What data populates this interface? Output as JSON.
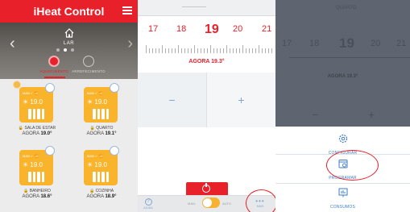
{
  "app": {
    "title": "iHeat Control"
  },
  "hero": {
    "home_label": "LAR",
    "tabs": [
      {
        "label": "AQUECIMENTO"
      },
      {
        "label": "ARREFECIMENTO"
      }
    ]
  },
  "rooms": [
    {
      "name": "SALA DE ESTAR",
      "now_label": "AGORA",
      "now_value": "19.0°",
      "card_temp": "19.0",
      "card_status": "MAN ✓ 📶"
    },
    {
      "name": "QUARTO",
      "now_label": "AGORA",
      "now_value": "19.1°",
      "card_temp": "19.0",
      "card_status": "MAN ✓ 📶"
    },
    {
      "name": "BANHEIRO",
      "now_label": "AGORA",
      "now_value": "18.6°",
      "card_temp": "19.0",
      "card_status": "MAN ✓ 📶"
    },
    {
      "name": "COZINHA",
      "now_label": "AGORA",
      "now_value": "18.9°",
      "card_temp": "19.0",
      "card_status": "MAN ✓ 📶"
    }
  ],
  "thermostat": {
    "scale": [
      "17",
      "18",
      "19",
      "20",
      "21"
    ],
    "selected": "19",
    "agora": "AGORA 19.3°",
    "minus": "−",
    "plus": "+"
  },
  "bottom_bar": {
    "help_label": "AJUDA",
    "help_symbol": "?",
    "man_label": "MAN.",
    "auto_label": "AUTO",
    "more_label": "MAIS",
    "more_symbol": "•••",
    "toggle_on": true
  },
  "background": {
    "room_label": "QUARTO",
    "scale": [
      "17",
      "18",
      "19",
      "20",
      "21"
    ],
    "agora": "AGORA 19.3°",
    "minus": "−",
    "plus": "+"
  },
  "menu": {
    "items": [
      {
        "label": "CONFIGURAR",
        "icon": "gear-icon"
      },
      {
        "label": "PROGRAMAR",
        "icon": "calendar-icon"
      },
      {
        "label": "CONSUMOS",
        "icon": "chart-icon"
      }
    ]
  },
  "colors": {
    "brand_red": "#e8202a",
    "card_orange": "#f9b42b",
    "link_blue": "#3e7bc4"
  }
}
